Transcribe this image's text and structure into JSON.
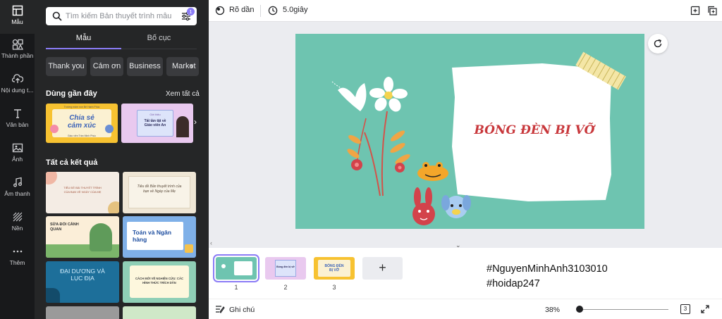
{
  "sidebar": {
    "items": [
      {
        "label": "Mẫu",
        "icon": "template-icon"
      },
      {
        "label": "Thành phần",
        "icon": "elements-icon"
      },
      {
        "label": "Nội dung t...",
        "icon": "upload-icon"
      },
      {
        "label": "Văn bản",
        "icon": "text-icon"
      },
      {
        "label": "Ảnh",
        "icon": "photo-icon"
      },
      {
        "label": "Âm thanh",
        "icon": "audio-icon"
      },
      {
        "label": "Nền",
        "icon": "background-icon"
      },
      {
        "label": "Thêm",
        "icon": "more-icon"
      }
    ]
  },
  "panel": {
    "search_placeholder": "Tìm kiếm Bản thuyết trình mẫu",
    "filter_badge": "1",
    "tabs": [
      "Mẫu",
      "Bố cục"
    ],
    "chips": [
      "Thank you",
      "Cảm ơn",
      "Business",
      "Market"
    ],
    "recent_title": "Dùng gần đây",
    "see_all": "Xem tất cả",
    "recent": [
      {
        "text": "Chia sẻ cảm xúc",
        "top": "Trường mầm non Bé Hạnh Phúc",
        "bottom": "Giáo viên Trần Minh Phúc"
      },
      {
        "text": "Tất tần tật về Giáo viên An",
        "top": "Giới thiệu"
      }
    ],
    "all_results_title": "Tất cả kết quả",
    "results": [
      {
        "text": "TIÊU ĐỀ BÀI THUYẾT TRÌNH CỦA BẠN VỀ NGÀY CỦA MẸ"
      },
      {
        "text": "Tiêu đề Bản thuyết trình của bạn về Ngày của Mẹ"
      },
      {
        "text": "SỬA ĐỔI CẢNH QUAN"
      },
      {
        "text": "Toán và Ngân hàng"
      },
      {
        "text": "ĐẠI DƯƠNG VÀ LỤC ĐỊA"
      },
      {
        "text": "CÁCH MỚI VỀ NGHIÊN CỨU: CÁC HÌNH THỨC TRÍCH DẪN"
      }
    ]
  },
  "topbar": {
    "fade_label": "Rõ dần",
    "duration_label": "5.0giây"
  },
  "slide": {
    "title": "BÓNG ĐÈN BỊ VỠ",
    "background_color": "#6ec4b0",
    "title_color": "#c8373b"
  },
  "filmstrip": {
    "pages": [
      "1",
      "2",
      "3"
    ],
    "thumb2_text": "Bóng đèn bị vỡ",
    "thumb3_text": "BÓNG ĐÈN BỊ VỠ"
  },
  "hashtags": [
    "#NguyenMinhAnh3103010",
    "#hoidap247"
  ],
  "bottombar": {
    "notes_label": "Ghi chú",
    "zoom": "38%",
    "zoom_fraction": 0.03,
    "page_count": "3"
  },
  "colors": {
    "accent": "#8b7cf6",
    "rail_bg": "#18191b",
    "panel_bg": "#252627"
  }
}
